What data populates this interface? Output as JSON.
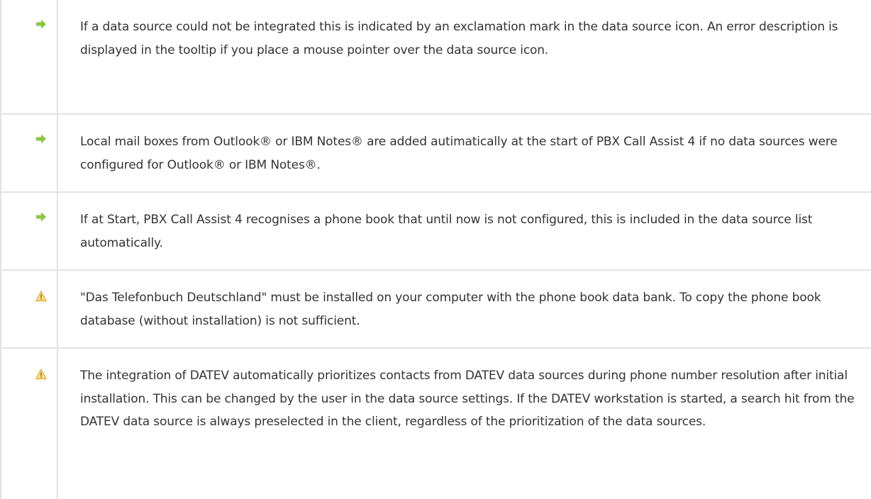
{
  "notes": [
    {
      "icon": "arrow-right-icon",
      "text": "If a data source could not be integrated this is indicated by an exclamation mark in the data source icon. An error description is displayed in the tooltip if you place a mouse pointer over the data source icon."
    },
    {
      "icon": "arrow-right-icon",
      "text": "Local mail boxes from Outlook® or IBM Notes® are added autimatically at the start of PBX Call Assist 4 if no data sources were configured for Outlook® or IBM Notes®."
    },
    {
      "icon": "arrow-right-icon",
      "text": "If at Start, PBX Call Assist 4 recognises a phone book that until now is not configured, this is included in the data source list automatically."
    },
    {
      "icon": "warning-icon",
      "text": "\"Das Telefonbuch Deutschland\" must be installed on your computer with the phone book data bank. To copy the phone book database (without installation) is not sufficient."
    },
    {
      "icon": "warning-icon",
      "text": "The integration of DATEV automatically prioritizes contacts from DATEV data sources during phone number resolution after initial installation. This can be changed by the user in the data source settings. If the DATEV workstation is started, a search hit from the DATEV data source is always preselected in the client, regardless of the prioritization of the data sources."
    }
  ],
  "colors": {
    "arrow_icon": "#8cc63f",
    "warning_icon_fill": "#fce08a",
    "warning_icon_stroke": "#e0a82e",
    "border": "#e3e3e3",
    "text": "#333333"
  }
}
